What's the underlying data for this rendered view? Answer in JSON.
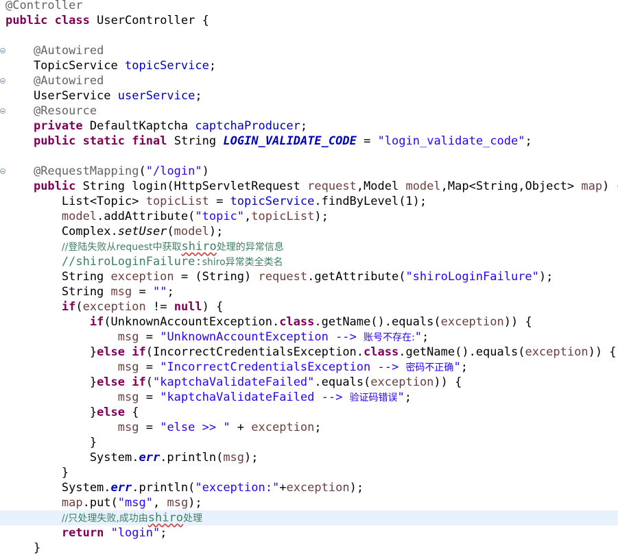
{
  "editor": {
    "current_line": 34,
    "fold_markers": [
      3,
      5,
      7,
      11
    ],
    "lines": [
      [
        {
          "t": "@Controller",
          "c": "ann"
        }
      ],
      [
        {
          "t": "public",
          "c": "kw"
        },
        {
          "t": " "
        },
        {
          "t": "class",
          "c": "kw"
        },
        {
          "t": " UserController {"
        }
      ],
      [],
      [
        {
          "t": "    "
        },
        {
          "t": "@Autowired",
          "c": "ann"
        }
      ],
      [
        {
          "t": "    TopicService "
        },
        {
          "t": "topicService",
          "c": "fld"
        },
        {
          "t": ";"
        }
      ],
      [
        {
          "t": "    "
        },
        {
          "t": "@Autowired",
          "c": "ann"
        }
      ],
      [
        {
          "t": "    UserService "
        },
        {
          "t": "userService",
          "c": "fld"
        },
        {
          "t": ";"
        }
      ],
      [
        {
          "t": "    "
        },
        {
          "t": "@Resource",
          "c": "ann"
        }
      ],
      [
        {
          "t": "    "
        },
        {
          "t": "private",
          "c": "kw"
        },
        {
          "t": " DefaultKaptcha "
        },
        {
          "t": "captchaProducer",
          "c": "fld"
        },
        {
          "t": ";"
        }
      ],
      [
        {
          "t": "    "
        },
        {
          "t": "public",
          "c": "kw"
        },
        {
          "t": " "
        },
        {
          "t": "static",
          "c": "kw"
        },
        {
          "t": " "
        },
        {
          "t": "final",
          "c": "kw"
        },
        {
          "t": " String "
        },
        {
          "t": "LOGIN_VALIDATE_CODE",
          "c": "sfld"
        },
        {
          "t": " = "
        },
        {
          "t": "\"login_validate_code\"",
          "c": "str"
        },
        {
          "t": ";"
        }
      ],
      [],
      [
        {
          "t": "    "
        },
        {
          "t": "@RequestMapping",
          "c": "ann"
        },
        {
          "t": "("
        },
        {
          "t": "\"/login\"",
          "c": "str"
        },
        {
          "t": ")"
        }
      ],
      [
        {
          "t": "    "
        },
        {
          "t": "public",
          "c": "kw"
        },
        {
          "t": " String login(HttpServletRequest "
        },
        {
          "t": "request",
          "c": "var"
        },
        {
          "t": ",Model "
        },
        {
          "t": "model",
          "c": "var"
        },
        {
          "t": ",Map<String,Object> "
        },
        {
          "t": "map",
          "c": "var"
        },
        {
          "t": ") {"
        }
      ],
      [
        {
          "t": "        List<Topic> "
        },
        {
          "t": "topicList",
          "c": "var"
        },
        {
          "t": " = "
        },
        {
          "t": "topicService",
          "c": "fld"
        },
        {
          "t": ".findByLevel(1);"
        }
      ],
      [
        {
          "t": "        "
        },
        {
          "t": "model",
          "c": "var"
        },
        {
          "t": ".addAttribute("
        },
        {
          "t": "\"topic\"",
          "c": "str"
        },
        {
          "t": ","
        },
        {
          "t": "topicList",
          "c": "var"
        },
        {
          "t": ");"
        }
      ],
      [
        {
          "t": "        Complex."
        },
        {
          "t": "setUser",
          "c": "ita"
        },
        {
          "t": "("
        },
        {
          "t": "model",
          "c": "var"
        },
        {
          "t": ");"
        }
      ],
      [
        {
          "t": "        "
        },
        {
          "t": "//登陆失败从request中获取",
          "c": "cmt"
        },
        {
          "t": "shiro",
          "c": "cmt sq"
        },
        {
          "t": "处理的异常信息",
          "c": "cmt cjk"
        }
      ],
      [
        {
          "t": "        "
        },
        {
          "t": "//shiroLoginFailure:",
          "c": "cmt"
        },
        {
          "t": "shiro异常类全类名",
          "c": "cmt cjk"
        }
      ],
      [
        {
          "t": "        String "
        },
        {
          "t": "exception",
          "c": "var"
        },
        {
          "t": " = (String) "
        },
        {
          "t": "request",
          "c": "var"
        },
        {
          "t": ".getAttribute("
        },
        {
          "t": "\"shiroLoginFailure\"",
          "c": "str"
        },
        {
          "t": ");"
        }
      ],
      [
        {
          "t": "        String "
        },
        {
          "t": "msg",
          "c": "var"
        },
        {
          "t": " = "
        },
        {
          "t": "\"\"",
          "c": "str"
        },
        {
          "t": ";"
        }
      ],
      [
        {
          "t": "        "
        },
        {
          "t": "if",
          "c": "kw"
        },
        {
          "t": "("
        },
        {
          "t": "exception",
          "c": "var"
        },
        {
          "t": " != "
        },
        {
          "t": "null",
          "c": "kw"
        },
        {
          "t": ") {"
        }
      ],
      [
        {
          "t": "            "
        },
        {
          "t": "if",
          "c": "kw"
        },
        {
          "t": "(UnknownAccountException."
        },
        {
          "t": "class",
          "c": "kw"
        },
        {
          "t": ".getName().equals("
        },
        {
          "t": "exception",
          "c": "var"
        },
        {
          "t": ")) {"
        }
      ],
      [
        {
          "t": "                "
        },
        {
          "t": "msg",
          "c": "var"
        },
        {
          "t": " = "
        },
        {
          "t": "\"UnknownAccountException --> ",
          "c": "str"
        },
        {
          "t": "账号不存在:",
          "c": "str cjk"
        },
        {
          "t": "\"",
          "c": "str"
        },
        {
          "t": ";"
        }
      ],
      [
        {
          "t": "            }"
        },
        {
          "t": "else",
          "c": "kw"
        },
        {
          "t": " "
        },
        {
          "t": "if",
          "c": "kw"
        },
        {
          "t": "(IncorrectCredentialsException."
        },
        {
          "t": "class",
          "c": "kw"
        },
        {
          "t": ".getName().equals("
        },
        {
          "t": "exception",
          "c": "var"
        },
        {
          "t": ")) {"
        }
      ],
      [
        {
          "t": "                "
        },
        {
          "t": "msg",
          "c": "var"
        },
        {
          "t": " = "
        },
        {
          "t": "\"IncorrectCredentialsException --> ",
          "c": "str"
        },
        {
          "t": "密码不正确",
          "c": "str cjk"
        },
        {
          "t": "\"",
          "c": "str"
        },
        {
          "t": ";"
        }
      ],
      [
        {
          "t": "            }"
        },
        {
          "t": "else",
          "c": "kw"
        },
        {
          "t": " "
        },
        {
          "t": "if",
          "c": "kw"
        },
        {
          "t": "("
        },
        {
          "t": "\"kaptchaValidateFailed\"",
          "c": "str"
        },
        {
          "t": ".equals("
        },
        {
          "t": "exception",
          "c": "var"
        },
        {
          "t": ")) {"
        }
      ],
      [
        {
          "t": "                "
        },
        {
          "t": "msg",
          "c": "var"
        },
        {
          "t": " = "
        },
        {
          "t": "\"kaptchaValidateFailed --> ",
          "c": "str"
        },
        {
          "t": "验证码错误",
          "c": "str cjk"
        },
        {
          "t": "\"",
          "c": "str"
        },
        {
          "t": ";"
        }
      ],
      [
        {
          "t": "            }"
        },
        {
          "t": "else",
          "c": "kw"
        },
        {
          "t": " {"
        }
      ],
      [
        {
          "t": "                "
        },
        {
          "t": "msg",
          "c": "var"
        },
        {
          "t": " = "
        },
        {
          "t": "\"else >> \"",
          "c": "str"
        },
        {
          "t": " + "
        },
        {
          "t": "exception",
          "c": "var"
        },
        {
          "t": ";"
        }
      ],
      [
        {
          "t": "            }"
        }
      ],
      [
        {
          "t": "            System."
        },
        {
          "t": "err",
          "c": "sfld"
        },
        {
          "t": ".println("
        },
        {
          "t": "msg",
          "c": "var"
        },
        {
          "t": ");"
        }
      ],
      [
        {
          "t": "        }"
        }
      ],
      [
        {
          "t": "        System."
        },
        {
          "t": "err",
          "c": "sfld"
        },
        {
          "t": ".println("
        },
        {
          "t": "\"exception:\"",
          "c": "str"
        },
        {
          "t": "+"
        },
        {
          "t": "exception",
          "c": "var"
        },
        {
          "t": ");"
        }
      ],
      [
        {
          "t": "        "
        },
        {
          "t": "map",
          "c": "var"
        },
        {
          "t": ".put("
        },
        {
          "t": "\"msg\"",
          "c": "str"
        },
        {
          "t": ", "
        },
        {
          "t": "msg",
          "c": "var"
        },
        {
          "t": ");"
        }
      ],
      [
        {
          "t": "        "
        },
        {
          "t": "//只处理失败,成功由",
          "c": "cmt"
        },
        {
          "t": "shiro",
          "c": "cmt sq"
        },
        {
          "t": "处理",
          "c": "cmt cjk"
        }
      ],
      [
        {
          "t": "        "
        },
        {
          "t": "return",
          "c": "kw"
        },
        {
          "t": " "
        },
        {
          "t": "\"login\"",
          "c": "str"
        },
        {
          "t": ";"
        }
      ],
      [
        {
          "t": "    }"
        }
      ]
    ]
  }
}
